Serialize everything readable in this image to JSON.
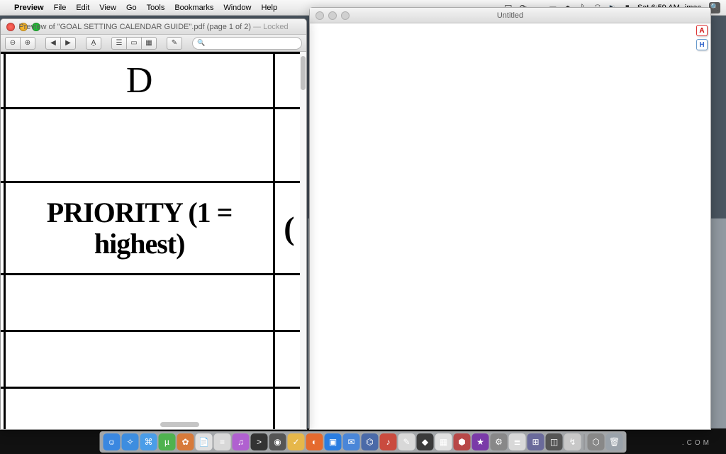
{
  "menubar": {
    "app_name": "Preview",
    "items": [
      "File",
      "Edit",
      "View",
      "Go",
      "Tools",
      "Bookmarks",
      "Window",
      "Help"
    ],
    "clock": "Sat 6:59 AM",
    "user": "imac"
  },
  "preview": {
    "title_prefix": "Preview of \"GOAL SETTING CALENDAR GUIDE\".pdf (page 1 of 2)",
    "title_suffix": " — Locked",
    "doc": {
      "cell_d": "D",
      "priority_text": "PRIORITY (1 = highest)",
      "paren": "("
    }
  },
  "untitled": {
    "title": "Untitled",
    "badge_a": "A",
    "badge_h": "H"
  },
  "background": {
    "com": ".COM"
  },
  "dock_icons": [
    {
      "name": "finder-icon",
      "color": "#3a87e0",
      "glyph": "☺"
    },
    {
      "name": "safari-icon",
      "color": "#3d8ddf",
      "glyph": "✧"
    },
    {
      "name": "xcode-icon",
      "color": "#4a9de8",
      "glyph": "⌘"
    },
    {
      "name": "utorrent-icon",
      "color": "#4fb24f",
      "glyph": "µ"
    },
    {
      "name": "palette-icon",
      "color": "#d77a3a",
      "glyph": "✿"
    },
    {
      "name": "doc-icon",
      "color": "#e0e0e0",
      "glyph": "📄"
    },
    {
      "name": "playlist-icon",
      "color": "#d8d8d8",
      "glyph": "≡"
    },
    {
      "name": "itunes-icon",
      "color": "#b060d0",
      "glyph": "♫"
    },
    {
      "name": "terminal-icon",
      "color": "#333",
      "glyph": ">"
    },
    {
      "name": "aperture-icon",
      "color": "#555",
      "glyph": "◉"
    },
    {
      "name": "todo-icon",
      "color": "#e6b74a",
      "glyph": "✓"
    },
    {
      "name": "firefox-icon",
      "color": "#e56a2e",
      "glyph": "◐"
    },
    {
      "name": "dropbox-icon",
      "color": "#2a7de1",
      "glyph": "▣"
    },
    {
      "name": "mail-icon",
      "color": "#4a86d8",
      "glyph": "✉"
    },
    {
      "name": "app1-icon",
      "color": "#4a6aa8",
      "glyph": "⌬"
    },
    {
      "name": "notes-icon",
      "color": "#c94b3f",
      "glyph": "♪"
    },
    {
      "name": "pages-icon",
      "color": "#d8d8d8",
      "glyph": "✎"
    },
    {
      "name": "app2-icon",
      "color": "#3a3a3a",
      "glyph": "◆"
    },
    {
      "name": "calendar-icon",
      "color": "#e0e0e0",
      "glyph": "▦"
    },
    {
      "name": "app3-icon",
      "color": "#b84848",
      "glyph": "⬢"
    },
    {
      "name": "app4-icon",
      "color": "#7a3aa8",
      "glyph": "★"
    },
    {
      "name": "settings-icon",
      "color": "#888",
      "glyph": "⚙"
    },
    {
      "name": "notepad-icon",
      "color": "#d8d8d8",
      "glyph": "≣"
    },
    {
      "name": "app5-icon",
      "color": "#6a6a9a",
      "glyph": "⊞"
    },
    {
      "name": "screenshot-icon",
      "color": "#555",
      "glyph": "◫"
    },
    {
      "name": "flow-icon",
      "color": "#c8c8c8",
      "glyph": "↯"
    },
    {
      "name": "app6-icon",
      "color": "#888",
      "glyph": "⬡"
    },
    {
      "name": "trash-icon",
      "color": "#9aa2aa",
      "glyph": "🗑"
    }
  ]
}
